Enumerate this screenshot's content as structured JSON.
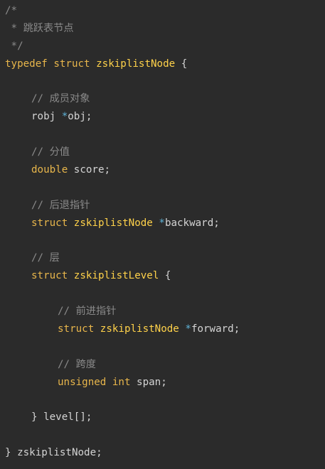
{
  "code": {
    "lines": [
      [
        {
          "t": "/*",
          "c": "comment"
        }
      ],
      [
        {
          "t": " * 跳跃表节点",
          "c": "comment"
        }
      ],
      [
        {
          "t": " */",
          "c": "comment"
        }
      ],
      [
        {
          "t": "typedef",
          "c": "kw"
        },
        {
          "t": " ",
          "c": "plain"
        },
        {
          "t": "struct",
          "c": "kw"
        },
        {
          "t": " ",
          "c": "plain"
        },
        {
          "t": "zskiplistNode",
          "c": "type"
        },
        {
          "t": " {",
          "c": "plain"
        }
      ],
      [],
      [
        {
          "t": "// 成员对象",
          "c": "comment"
        }
      ],
      [
        {
          "t": "robj ",
          "c": "plain"
        },
        {
          "t": "*",
          "c": "ptr"
        },
        {
          "t": "obj;",
          "c": "plain"
        }
      ],
      [],
      [
        {
          "t": "// 分值",
          "c": "comment"
        }
      ],
      [
        {
          "t": "double",
          "c": "kw"
        },
        {
          "t": " score;",
          "c": "plain"
        }
      ],
      [],
      [
        {
          "t": "// 后退指针",
          "c": "comment"
        }
      ],
      [
        {
          "t": "struct",
          "c": "kw"
        },
        {
          "t": " ",
          "c": "plain"
        },
        {
          "t": "zskiplistNode",
          "c": "type"
        },
        {
          "t": " ",
          "c": "plain"
        },
        {
          "t": "*",
          "c": "ptr"
        },
        {
          "t": "backward;",
          "c": "plain"
        }
      ],
      [],
      [
        {
          "t": "// 层",
          "c": "comment"
        }
      ],
      [
        {
          "t": "struct",
          "c": "kw"
        },
        {
          "t": " ",
          "c": "plain"
        },
        {
          "t": "zskiplistLevel",
          "c": "type"
        },
        {
          "t": " {",
          "c": "plain"
        }
      ],
      [],
      [
        {
          "t": "// 前进指针",
          "c": "comment"
        }
      ],
      [
        {
          "t": "struct",
          "c": "kw"
        },
        {
          "t": " ",
          "c": "plain"
        },
        {
          "t": "zskiplistNode",
          "c": "type"
        },
        {
          "t": " ",
          "c": "plain"
        },
        {
          "t": "*",
          "c": "ptr"
        },
        {
          "t": "forward;",
          "c": "plain"
        }
      ],
      [],
      [
        {
          "t": "// 跨度",
          "c": "comment"
        }
      ],
      [
        {
          "t": "unsigned",
          "c": "kw"
        },
        {
          "t": " ",
          "c": "plain"
        },
        {
          "t": "int",
          "c": "kw"
        },
        {
          "t": " span;",
          "c": "plain"
        }
      ],
      [],
      [
        {
          "t": "} level[];",
          "c": "plain"
        }
      ],
      [],
      [
        {
          "t": "} zskiplistNode;",
          "c": "plain"
        }
      ]
    ]
  },
  "colors": {
    "background": "#2b2b2b",
    "comment": "#8a8a8a",
    "keyword": "#e8b64b",
    "type": "#ffd24a",
    "pointer": "#5fb4d9",
    "text": "#d4d4d4"
  }
}
